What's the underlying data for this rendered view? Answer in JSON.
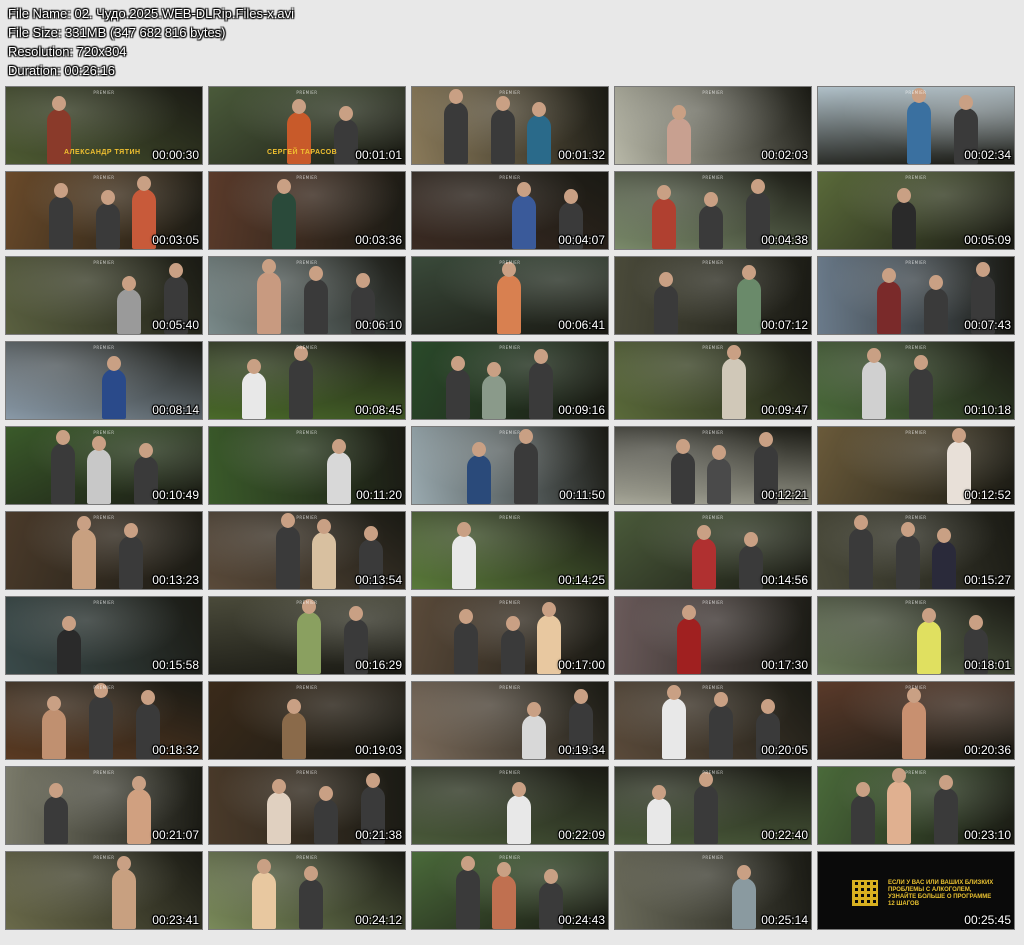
{
  "file_info": {
    "name_line": "File Name: 02. Чудо.2025.WEB-DLRip.Files-x.avi",
    "size_line": "File Size: 331MB (347 682 816 bytes)",
    "resolution_line": "Resolution: 720x304",
    "duration_line": "Duration: 00:26:16"
  },
  "watermark": "PREMIER",
  "thumbnails": [
    {
      "time": "00:00:30",
      "bg": "#4d5a32",
      "accent": "#8a3a2a",
      "credit": "АЛЕКСАНДР ТЯТИН"
    },
    {
      "time": "00:01:01",
      "bg": "#4a5a3a",
      "accent": "#c85a2a",
      "credit": "СЕРГЕЙ ТАРАСОВ"
    },
    {
      "time": "00:01:32",
      "bg": "#8a7a5a",
      "accent": "#2a6a8a"
    },
    {
      "time": "00:02:03",
      "bg": "#b8b8a8",
      "accent": "#c8a090"
    },
    {
      "time": "00:02:34",
      "bg": "#b0c0c8",
      "accent": "#3a70a0"
    },
    {
      "time": "00:03:05",
      "bg": "#6a4a2a",
      "accent": "#c85a3a"
    },
    {
      "time": "00:03:36",
      "bg": "#5a3a2a",
      "accent": "#2a4a3a"
    },
    {
      "time": "00:04:07",
      "bg": "#3a2a22",
      "accent": "#3a5a9a"
    },
    {
      "time": "00:04:38",
      "bg": "#7a8a6a",
      "accent": "#b04030"
    },
    {
      "time": "00:05:09",
      "bg": "#5a6a3a",
      "accent": "#2a2a2a"
    },
    {
      "time": "00:05:40",
      "bg": "#5a6040",
      "accent": "#9a9a9a"
    },
    {
      "time": "00:06:10",
      "bg": "#7a8a8a",
      "accent": "#c89a80"
    },
    {
      "time": "00:06:41",
      "bg": "#3a4a3a",
      "accent": "#d88050"
    },
    {
      "time": "00:07:12",
      "bg": "#4a4a3a",
      "accent": "#6a8a6a"
    },
    {
      "time": "00:07:43",
      "bg": "#6a7a8a",
      "accent": "#7a2a2a"
    },
    {
      "time": "00:08:14",
      "bg": "#8a9aa8",
      "accent": "#2a4a8a"
    },
    {
      "time": "00:08:45",
      "bg": "#4a6a2a",
      "accent": "#e8e8e8"
    },
    {
      "time": "00:09:16",
      "bg": "#2a4a2a",
      "accent": "#8a9a8a"
    },
    {
      "time": "00:09:47",
      "bg": "#5a6a3a",
      "accent": "#d0c8b8"
    },
    {
      "time": "00:10:18",
      "bg": "#4a6a3a",
      "accent": "#d0d0d0"
    },
    {
      "time": "00:10:49",
      "bg": "#3a5a2a",
      "accent": "#c8c8c8"
    },
    {
      "time": "00:11:20",
      "bg": "#3a5a2a",
      "accent": "#d8d8d8"
    },
    {
      "time": "00:11:50",
      "bg": "#9aaab0",
      "accent": "#2a4a7a"
    },
    {
      "time": "00:12:21",
      "bg": "#a8a89a",
      "accent": "#4a4a4a"
    },
    {
      "time": "00:12:52",
      "bg": "#6a5a3a",
      "accent": "#e8e0d8"
    },
    {
      "time": "00:13:23",
      "bg": "#4a3a2a",
      "accent": "#c8a080"
    },
    {
      "time": "00:13:54",
      "bg": "#5a4a3a",
      "accent": "#d8c0a0"
    },
    {
      "time": "00:14:25",
      "bg": "#5a7a3a",
      "accent": "#e8e8e8"
    },
    {
      "time": "00:14:56",
      "bg": "#4a5a3a",
      "accent": "#b03030"
    },
    {
      "time": "00:15:27",
      "bg": "#4a4a3a",
      "accent": "#2a2a3a"
    },
    {
      "time": "00:15:58",
      "bg": "#3a4a4a",
      "accent": "#2a2a2a"
    },
    {
      "time": "00:16:29",
      "bg": "#4a4a3a",
      "accent": "#8aa060"
    },
    {
      "time": "00:17:00",
      "bg": "#5a4a3a",
      "accent": "#e8c8a0"
    },
    {
      "time": "00:17:30",
      "bg": "#6a5a5a",
      "accent": "#a02020"
    },
    {
      "time": "00:18:01",
      "bg": "#6a7a5a",
      "accent": "#e0e060"
    },
    {
      "time": "00:18:32",
      "bg": "#5a3a22",
      "accent": "#c09070"
    },
    {
      "time": "00:19:03",
      "bg": "#3a2a1a",
      "accent": "#8a6a4a"
    },
    {
      "time": "00:19:34",
      "bg": "#7a6a5a",
      "accent": "#d8d8d8"
    },
    {
      "time": "00:20:05",
      "bg": "#5a4a3a",
      "accent": "#e8e8e8"
    },
    {
      "time": "00:20:36",
      "bg": "#5a3a2a",
      "accent": "#c89070"
    },
    {
      "time": "00:21:07",
      "bg": "#7a7a6a",
      "accent": "#d0a080"
    },
    {
      "time": "00:21:38",
      "bg": "#4a3a2a",
      "accent": "#e0d0c0"
    },
    {
      "time": "00:22:09",
      "bg": "#4a5a3a",
      "accent": "#e8e8e8"
    },
    {
      "time": "00:22:40",
      "bg": "#4a5a3a",
      "accent": "#e8e8e8"
    },
    {
      "time": "00:23:10",
      "bg": "#4a6a3a",
      "accent": "#e0b090"
    },
    {
      "time": "00:23:41",
      "bg": "#6a6a4a",
      "accent": "#c8a080"
    },
    {
      "time": "00:24:12",
      "bg": "#7a8a5a",
      "accent": "#e8c8a0"
    },
    {
      "time": "00:24:43",
      "bg": "#4a6a3a",
      "accent": "#c07050"
    },
    {
      "time": "00:25:14",
      "bg": "#6a6a5a",
      "accent": "#8a9aa0"
    },
    {
      "time": "00:25:45",
      "bg": "#0a0a0a",
      "accent": "#e8c030",
      "is_ad": true,
      "ad_text": "ЕСЛИ У ВАС ИЛИ ВАШИХ БЛИЗКИХ ПРОБЛЕМЫ С АЛКОГОЛЕМ, УЗНАЙТЕ БОЛЬШЕ О ПРОГРАММЕ 12 ШАГОВ"
    }
  ]
}
